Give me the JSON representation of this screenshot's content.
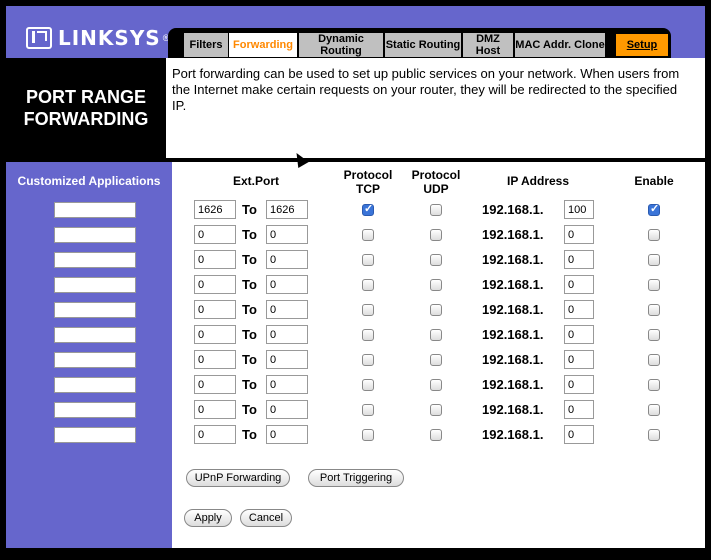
{
  "brand": {
    "name": "LINKSYS",
    "reg": "®"
  },
  "tabs": [
    {
      "label": "Filters"
    },
    {
      "label": "Forwarding"
    },
    {
      "label": "Dynamic Routing"
    },
    {
      "label": "Static Routing"
    },
    {
      "label": "DMZ Host"
    },
    {
      "label": "MAC Addr. Clone"
    },
    {
      "label": "Setup"
    }
  ],
  "page": {
    "title_line1": "PORT RANGE",
    "title_line2": "FORWARDING",
    "description": "Port forwarding can be used to set up public services on your network. When users from the Internet make certain requests on your router, they will be redirected to the specified IP."
  },
  "table": {
    "left_header": "Customized Applications",
    "ext_port_header": "Ext.Port",
    "tcp_header": "Protocol TCP",
    "udp_header": "Protocol UDP",
    "ip_header": "IP Address",
    "enable_header": "Enable",
    "to_label": "To",
    "ip_prefix": "192.168.1.",
    "rows": [
      {
        "app": "",
        "from": "1626",
        "to": "1626",
        "tcp": true,
        "udp": false,
        "ip": "100",
        "enable": true
      },
      {
        "app": "",
        "from": "0",
        "to": "0",
        "tcp": false,
        "udp": false,
        "ip": "0",
        "enable": false
      },
      {
        "app": "",
        "from": "0",
        "to": "0",
        "tcp": false,
        "udp": false,
        "ip": "0",
        "enable": false
      },
      {
        "app": "",
        "from": "0",
        "to": "0",
        "tcp": false,
        "udp": false,
        "ip": "0",
        "enable": false
      },
      {
        "app": "",
        "from": "0",
        "to": "0",
        "tcp": false,
        "udp": false,
        "ip": "0",
        "enable": false
      },
      {
        "app": "",
        "from": "0",
        "to": "0",
        "tcp": false,
        "udp": false,
        "ip": "0",
        "enable": false
      },
      {
        "app": "",
        "from": "0",
        "to": "0",
        "tcp": false,
        "udp": false,
        "ip": "0",
        "enable": false
      },
      {
        "app": "",
        "from": "0",
        "to": "0",
        "tcp": false,
        "udp": false,
        "ip": "0",
        "enable": false
      },
      {
        "app": "",
        "from": "0",
        "to": "0",
        "tcp": false,
        "udp": false,
        "ip": "0",
        "enable": false
      },
      {
        "app": "",
        "from": "0",
        "to": "0",
        "tcp": false,
        "udp": false,
        "ip": "0",
        "enable": false
      }
    ]
  },
  "buttons": {
    "upnp": "UPnP Forwarding",
    "triggering": "Port Triggering",
    "apply": "Apply",
    "cancel": "Cancel"
  },
  "colors": {
    "brand_purple": "#6666cc",
    "active_tab_text": "#ff8800",
    "setup_tab": "#ff9900",
    "checkbox_on": "#3a74d8"
  }
}
